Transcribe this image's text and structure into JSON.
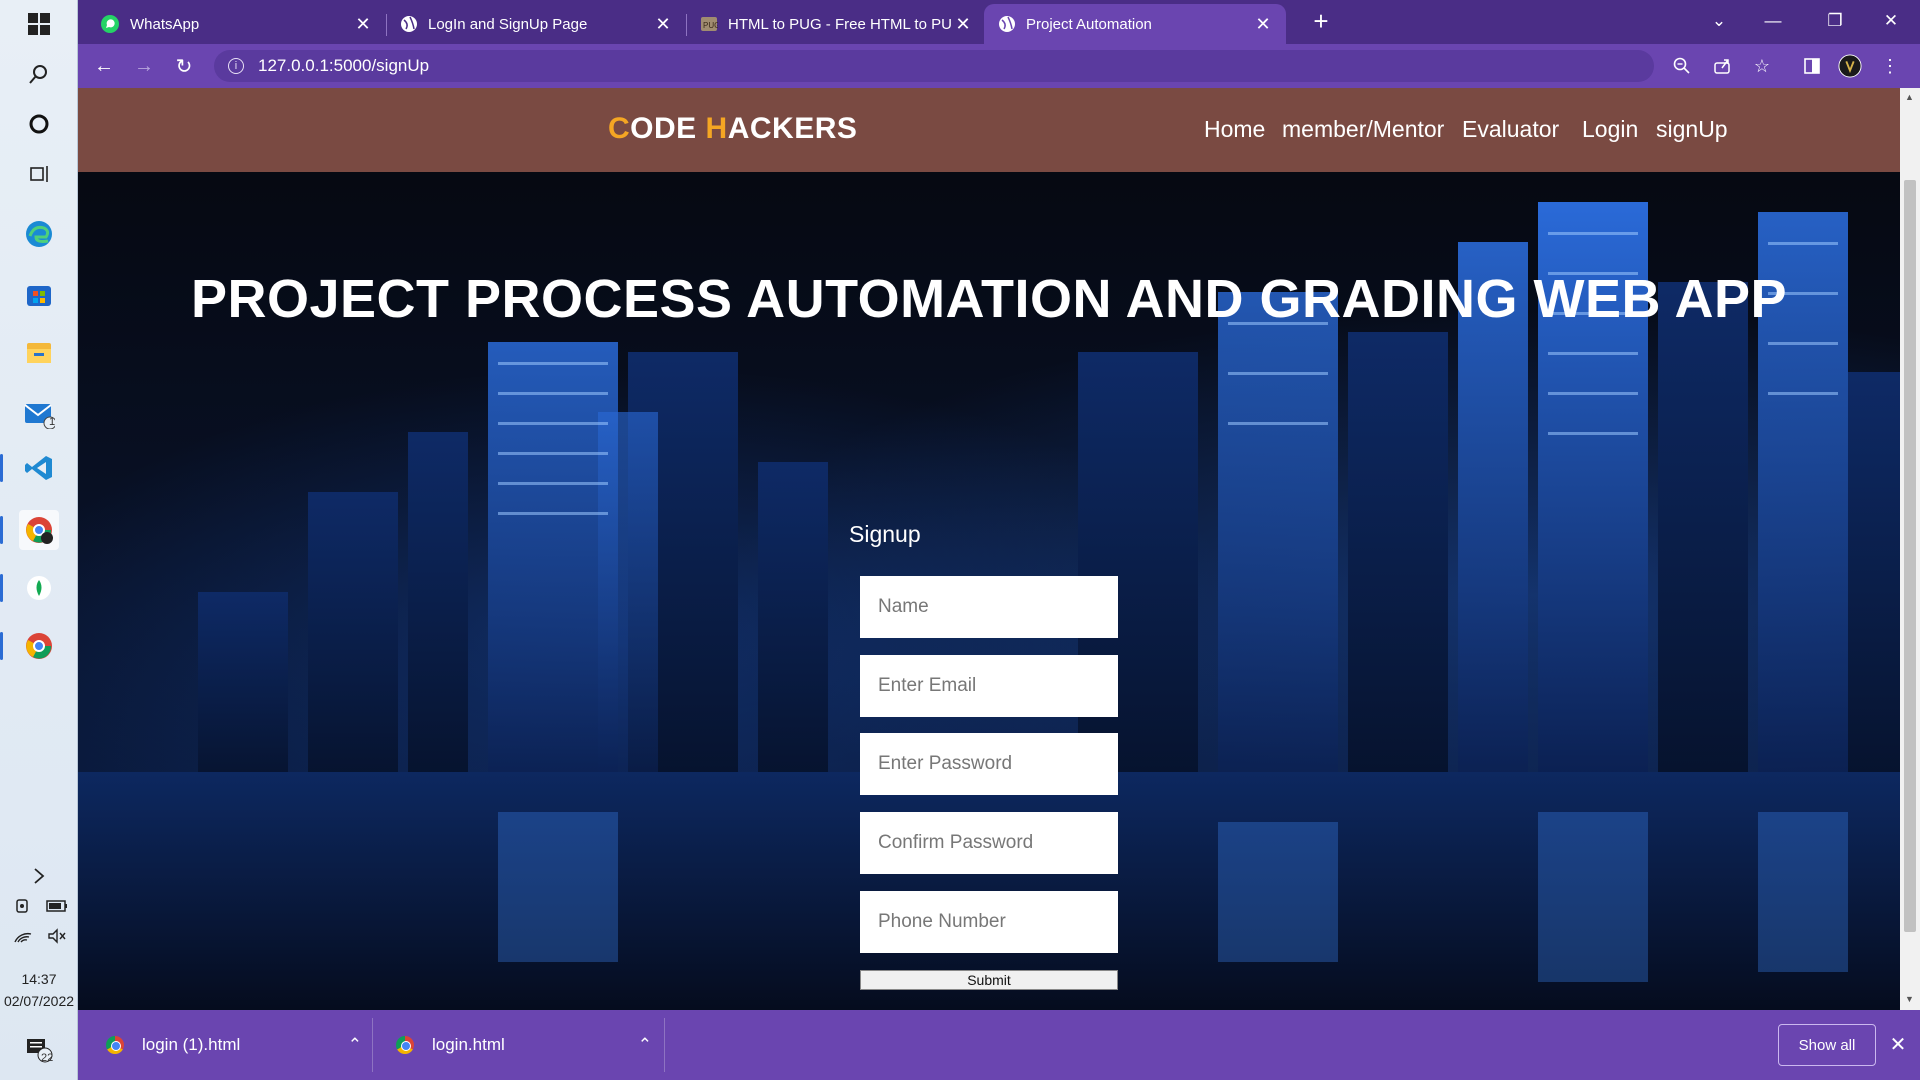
{
  "taskbar": {
    "badge_mail": "1",
    "time": "14:37",
    "date": "02/07/2022",
    "notification_count": "22"
  },
  "browser": {
    "tabs": [
      {
        "title": "WhatsApp",
        "icon": "whatsapp-icon"
      },
      {
        "title": "LogIn and SignUp Page",
        "icon": "globe-icon"
      },
      {
        "title": "HTML to PUG - Free HTML to PU",
        "icon": "pug-icon"
      },
      {
        "title": "Project Automation",
        "icon": "globe-icon",
        "active": true
      }
    ],
    "url": "127.0.0.1:5000/signUp"
  },
  "site": {
    "brand_c": "C",
    "brand_ode": "ODE ",
    "brand_h": "H",
    "brand_ackers": "ACKERS",
    "nav": [
      "Home",
      "member/Mentor",
      "Evaluator",
      "Login",
      "signUp"
    ],
    "hero_title": "PROJECT PROCESS AUTOMATION AND GRADING WEB APP",
    "form": {
      "heading": "Signup",
      "name_placeholder": "Name",
      "email_placeholder": "Enter Email",
      "password_placeholder": "Enter Password",
      "confirm_placeholder": "Confirm Password",
      "phone_placeholder": "Phone Number",
      "submit_label": "Submit"
    }
  },
  "downloads": {
    "items": [
      "login (1).html",
      "login.html"
    ],
    "show_all_label": "Show all"
  },
  "colors": {
    "browser_frame": "#4a2d86",
    "toolbar": "#6a45b0",
    "site_nav": "#7a4a42",
    "brand_accent": "#f5a623"
  }
}
